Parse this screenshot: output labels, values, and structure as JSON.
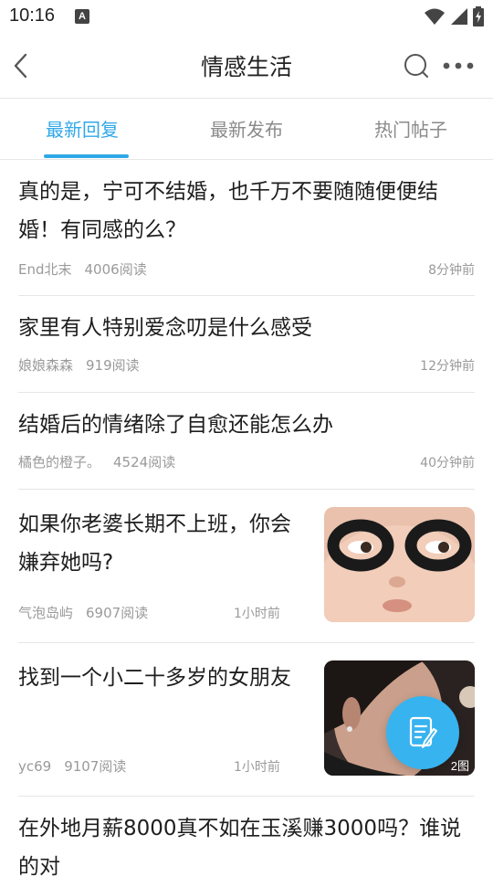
{
  "status_bar": {
    "time": "10:16",
    "notification_badge": "A"
  },
  "nav": {
    "title": "情感生活"
  },
  "tabs": [
    {
      "label": "最新回复",
      "active": true
    },
    {
      "label": "最新发布",
      "active": false
    },
    {
      "label": "热门帖子",
      "active": false
    }
  ],
  "posts": [
    {
      "title": "真的是，宁可不结婚，也千万不要随随便便结婚！有同感的么？",
      "author": "End北末",
      "views": "4006阅读",
      "time": "8分钟前"
    },
    {
      "title": "家里有人特别爱念叨是什么感受",
      "author": "娘娘森森",
      "views": "919阅读",
      "time": "12分钟前"
    },
    {
      "title": "结婚后的情绪除了自愈还能怎么办",
      "author": "橘色的橙子。",
      "views": "4524阅读",
      "time": "40分钟前"
    },
    {
      "title": "如果你老婆长期不上班，你会嫌弃她吗?",
      "author": "气泡岛屿",
      "views": "6907阅读",
      "time": "1小时前"
    },
    {
      "title": "找到一个小二十多岁的女朋友",
      "author": "yc69",
      "views": "9107阅读",
      "time": "1小时前",
      "image_count": "2图"
    },
    {
      "title": "在外地月薪8000真不如在玉溪赚3000吗？谁说的对"
    }
  ],
  "colors": {
    "accent": "#30a8e8",
    "fab": "#37b3f0",
    "divider": "#e6e6e6",
    "meta_text": "#9a9a9a"
  },
  "icons": {
    "back": "chevron-left-icon",
    "search": "search-icon",
    "more": "more-dots-icon",
    "fab": "edit-note-icon"
  }
}
